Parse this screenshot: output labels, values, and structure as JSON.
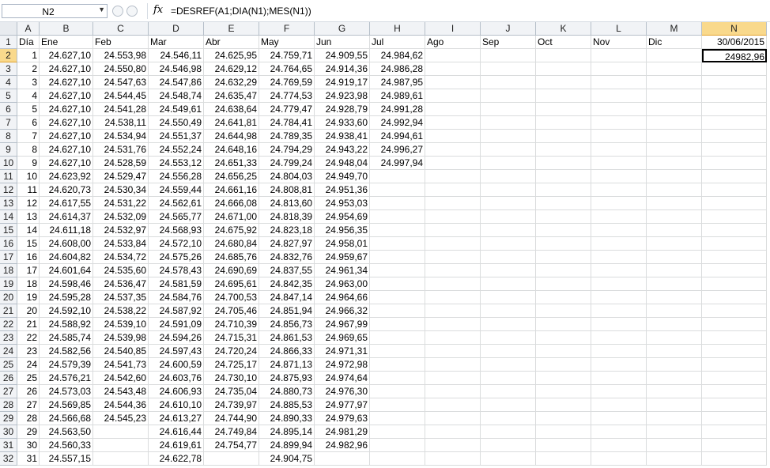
{
  "name_box": {
    "value": "N2"
  },
  "formula_bar": {
    "fx_icon": "fx",
    "formula": "=DESREF(A1;DIA(N1);MES(N1))"
  },
  "columns": [
    "A",
    "B",
    "C",
    "D",
    "E",
    "F",
    "G",
    "H",
    "I",
    "J",
    "K",
    "L",
    "M",
    "N"
  ],
  "row_numbers": [
    "1",
    "2",
    "3",
    "4",
    "5",
    "6",
    "7",
    "8",
    "9",
    "10",
    "11",
    "12",
    "13",
    "14",
    "15",
    "16",
    "17",
    "18",
    "19",
    "20",
    "21",
    "22",
    "23",
    "24",
    "25",
    "26",
    "27",
    "28",
    "29",
    "30",
    "31",
    "32"
  ],
  "active_cell": "N2",
  "header_row": [
    "Día",
    "Ene",
    "Feb",
    "Mar",
    "Abr",
    "May",
    "Jun",
    "Jul",
    "Ago",
    "Sep",
    "Oct",
    "Nov",
    "Dic",
    "30/06/2015"
  ],
  "data_rows": [
    [
      "1",
      "24.627,10",
      "24.553,98",
      "24.546,11",
      "24.625,95",
      "24.759,71",
      "24.909,55",
      "24.984,62",
      "",
      "",
      "",
      "",
      "",
      "24982,96"
    ],
    [
      "2",
      "24.627,10",
      "24.550,80",
      "24.546,98",
      "24.629,12",
      "24.764,65",
      "24.914,36",
      "24.986,28",
      "",
      "",
      "",
      "",
      "",
      ""
    ],
    [
      "3",
      "24.627,10",
      "24.547,63",
      "24.547,86",
      "24.632,29",
      "24.769,59",
      "24.919,17",
      "24.987,95",
      "",
      "",
      "",
      "",
      "",
      ""
    ],
    [
      "4",
      "24.627,10",
      "24.544,45",
      "24.548,74",
      "24.635,47",
      "24.774,53",
      "24.923,98",
      "24.989,61",
      "",
      "",
      "",
      "",
      "",
      ""
    ],
    [
      "5",
      "24.627,10",
      "24.541,28",
      "24.549,61",
      "24.638,64",
      "24.779,47",
      "24.928,79",
      "24.991,28",
      "",
      "",
      "",
      "",
      "",
      ""
    ],
    [
      "6",
      "24.627,10",
      "24.538,11",
      "24.550,49",
      "24.641,81",
      "24.784,41",
      "24.933,60",
      "24.992,94",
      "",
      "",
      "",
      "",
      "",
      ""
    ],
    [
      "7",
      "24.627,10",
      "24.534,94",
      "24.551,37",
      "24.644,98",
      "24.789,35",
      "24.938,41",
      "24.994,61",
      "",
      "",
      "",
      "",
      "",
      ""
    ],
    [
      "8",
      "24.627,10",
      "24.531,76",
      "24.552,24",
      "24.648,16",
      "24.794,29",
      "24.943,22",
      "24.996,27",
      "",
      "",
      "",
      "",
      "",
      ""
    ],
    [
      "9",
      "24.627,10",
      "24.528,59",
      "24.553,12",
      "24.651,33",
      "24.799,24",
      "24.948,04",
      "24.997,94",
      "",
      "",
      "",
      "",
      "",
      ""
    ],
    [
      "10",
      "24.623,92",
      "24.529,47",
      "24.556,28",
      "24.656,25",
      "24.804,03",
      "24.949,70",
      "",
      "",
      "",
      "",
      "",
      "",
      ""
    ],
    [
      "11",
      "24.620,73",
      "24.530,34",
      "24.559,44",
      "24.661,16",
      "24.808,81",
      "24.951,36",
      "",
      "",
      "",
      "",
      "",
      "",
      ""
    ],
    [
      "12",
      "24.617,55",
      "24.531,22",
      "24.562,61",
      "24.666,08",
      "24.813,60",
      "24.953,03",
      "",
      "",
      "",
      "",
      "",
      "",
      ""
    ],
    [
      "13",
      "24.614,37",
      "24.532,09",
      "24.565,77",
      "24.671,00",
      "24.818,39",
      "24.954,69",
      "",
      "",
      "",
      "",
      "",
      "",
      ""
    ],
    [
      "14",
      "24.611,18",
      "24.532,97",
      "24.568,93",
      "24.675,92",
      "24.823,18",
      "24.956,35",
      "",
      "",
      "",
      "",
      "",
      "",
      ""
    ],
    [
      "15",
      "24.608,00",
      "24.533,84",
      "24.572,10",
      "24.680,84",
      "24.827,97",
      "24.958,01",
      "",
      "",
      "",
      "",
      "",
      "",
      ""
    ],
    [
      "16",
      "24.604,82",
      "24.534,72",
      "24.575,26",
      "24.685,76",
      "24.832,76",
      "24.959,67",
      "",
      "",
      "",
      "",
      "",
      "",
      ""
    ],
    [
      "17",
      "24.601,64",
      "24.535,60",
      "24.578,43",
      "24.690,69",
      "24.837,55",
      "24.961,34",
      "",
      "",
      "",
      "",
      "",
      "",
      ""
    ],
    [
      "18",
      "24.598,46",
      "24.536,47",
      "24.581,59",
      "24.695,61",
      "24.842,35",
      "24.963,00",
      "",
      "",
      "",
      "",
      "",
      "",
      ""
    ],
    [
      "19",
      "24.595,28",
      "24.537,35",
      "24.584,76",
      "24.700,53",
      "24.847,14",
      "24.964,66",
      "",
      "",
      "",
      "",
      "",
      "",
      ""
    ],
    [
      "20",
      "24.592,10",
      "24.538,22",
      "24.587,92",
      "24.705,46",
      "24.851,94",
      "24.966,32",
      "",
      "",
      "",
      "",
      "",
      "",
      ""
    ],
    [
      "21",
      "24.588,92",
      "24.539,10",
      "24.591,09",
      "24.710,39",
      "24.856,73",
      "24.967,99",
      "",
      "",
      "",
      "",
      "",
      "",
      ""
    ],
    [
      "22",
      "24.585,74",
      "24.539,98",
      "24.594,26",
      "24.715,31",
      "24.861,53",
      "24.969,65",
      "",
      "",
      "",
      "",
      "",
      "",
      ""
    ],
    [
      "23",
      "24.582,56",
      "24.540,85",
      "24.597,43",
      "24.720,24",
      "24.866,33",
      "24.971,31",
      "",
      "",
      "",
      "",
      "",
      "",
      ""
    ],
    [
      "24",
      "24.579,39",
      "24.541,73",
      "24.600,59",
      "24.725,17",
      "24.871,13",
      "24.972,98",
      "",
      "",
      "",
      "",
      "",
      "",
      ""
    ],
    [
      "25",
      "24.576,21",
      "24.542,60",
      "24.603,76",
      "24.730,10",
      "24.875,93",
      "24.974,64",
      "",
      "",
      "",
      "",
      "",
      "",
      ""
    ],
    [
      "26",
      "24.573,03",
      "24.543,48",
      "24.606,93",
      "24.735,04",
      "24.880,73",
      "24.976,30",
      "",
      "",
      "",
      "",
      "",
      "",
      ""
    ],
    [
      "27",
      "24.569,85",
      "24.544,36",
      "24.610,10",
      "24.739,97",
      "24.885,53",
      "24.977,97",
      "",
      "",
      "",
      "",
      "",
      "",
      ""
    ],
    [
      "28",
      "24.566,68",
      "24.545,23",
      "24.613,27",
      "24.744,90",
      "24.890,33",
      "24.979,63",
      "",
      "",
      "",
      "",
      "",
      "",
      ""
    ],
    [
      "29",
      "24.563,50",
      "",
      "24.616,44",
      "24.749,84",
      "24.895,14",
      "24.981,29",
      "",
      "",
      "",
      "",
      "",
      "",
      ""
    ],
    [
      "30",
      "24.560,33",
      "",
      "24.619,61",
      "24.754,77",
      "24.899,94",
      "24.982,96",
      "",
      "",
      "",
      "",
      "",
      "",
      ""
    ],
    [
      "31",
      "24.557,15",
      "",
      "24.622,78",
      "",
      "24.904,75",
      "",
      "",
      "",
      "",
      "",
      "",
      "",
      ""
    ]
  ]
}
